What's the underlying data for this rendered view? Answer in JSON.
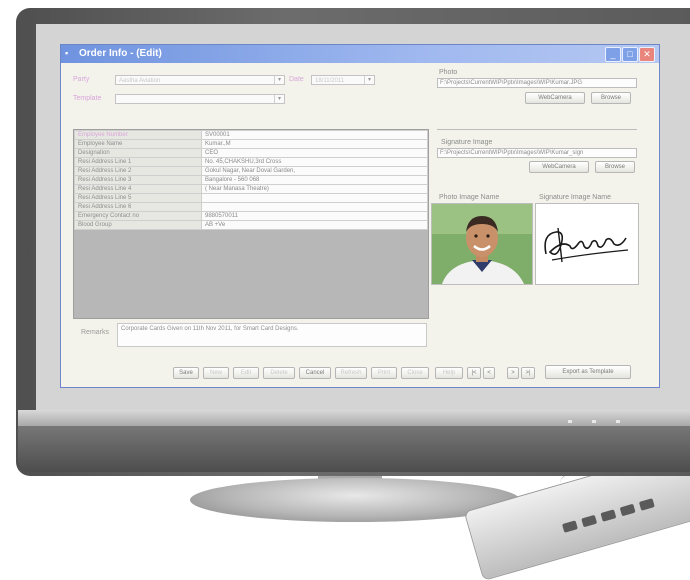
{
  "window": {
    "title": "Order Info - (Edit)",
    "minimize_glyph": "_",
    "maximize_glyph": "□",
    "close_glyph": "✕"
  },
  "form": {
    "party_label": "Party",
    "party_value": "Aastha Aviation",
    "date_label": "Date",
    "date_value": "18/11/2011",
    "template_label": "Template",
    "template_value": ""
  },
  "grid": {
    "rows": [
      {
        "field": "Employee Number",
        "value": "SV00001"
      },
      {
        "field": "Employee Name",
        "value": "Kumar.,M"
      },
      {
        "field": "Designation",
        "value": "CEO"
      },
      {
        "field": "Resi Address Line 1",
        "value": "No. 45,CHAKSHU,3rd Cross"
      },
      {
        "field": "Resi Address Line 2",
        "value": "Gokul Nagar, Near Doval Garden,"
      },
      {
        "field": "Resi Address Line 3",
        "value": "Bangalore - 560 068"
      },
      {
        "field": "Resi Address Line 4",
        "value": "( Near Manasa Theatre)"
      },
      {
        "field": "Resi Address Line 5",
        "value": ""
      },
      {
        "field": "Resi Address Line 6",
        "value": ""
      },
      {
        "field": "Emergency Contact no",
        "value": "9880570011"
      },
      {
        "field": "Blood Group",
        "value": "AB +Ve"
      }
    ]
  },
  "remarks": {
    "label": "Remarks",
    "value": "Corporate Cards Given on 11th Nov 2011, for Smart Card Designs."
  },
  "photo": {
    "label": "Photo",
    "path": "F:\\Projects\\CurrentWIP\\Pptx\\Images\\WIP\\Kumar.JPG",
    "webcam_label": "WebCamera",
    "browse_label": "Browse"
  },
  "signature": {
    "label": "Signature Image",
    "path": "F:\\Projects\\CurrentWIP\\Pptx\\Images\\WIP\\Kumar_sign",
    "webcam_label": "WebCamera",
    "browse_label": "Browse"
  },
  "previews": {
    "photo_label": "Photo Image Name",
    "signature_label": "Signature Image Name"
  },
  "toolbar": {
    "save": "Save",
    "new": "New",
    "edit": "Edit",
    "delete": "Delete",
    "cancel": "Cancel",
    "refresh": "Refresh",
    "print": "Print",
    "close": "Close",
    "help": "Help",
    "first": "|<",
    "prev": "<",
    "next": ">",
    "last": ">|",
    "export": "Export as Template"
  }
}
